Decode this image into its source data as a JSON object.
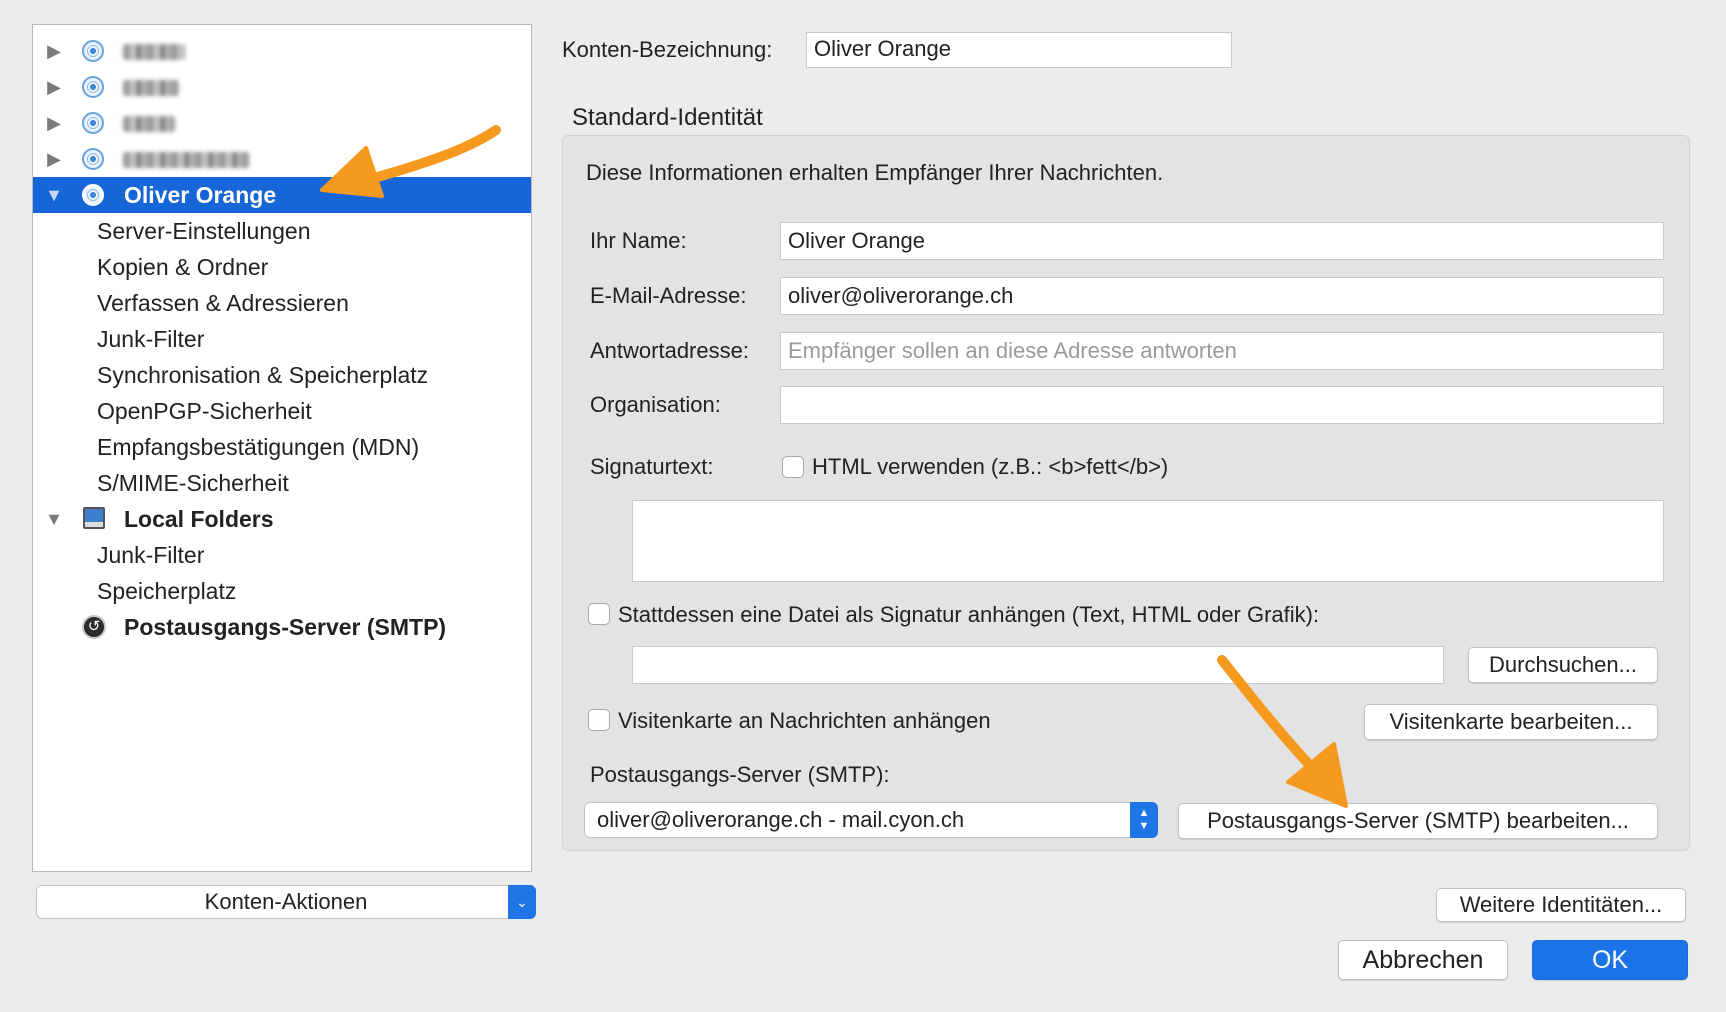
{
  "tree": {
    "accounts_collapsed_count": 4,
    "selected_account": "Oliver Orange",
    "account_children": [
      "Server-Einstellungen",
      "Kopien & Ordner",
      "Verfassen & Adressieren",
      "Junk-Filter",
      "Synchronisation & Speicherplatz",
      "OpenPGP-Sicherheit",
      "Empfangsbestätigungen (MDN)",
      "S/MIME-Sicherheit"
    ],
    "local_folders": "Local Folders",
    "local_children": [
      "Junk-Filter",
      "Speicherplatz"
    ],
    "smtp": "Postausgangs-Server (SMTP)"
  },
  "konten_aktionen": "Konten-Aktionen",
  "account": {
    "label": "Konten-Bezeichnung:",
    "value": "Oliver Orange"
  },
  "identity": {
    "title": "Standard-Identität",
    "info": "Diese Informationen erhalten Empfänger Ihrer Nachrichten.",
    "name_label": "Ihr Name:",
    "name_value": "Oliver Orange",
    "email_label": "E-Mail-Adresse:",
    "email_value": "oliver@oliverorange.ch",
    "reply_label": "Antwortadresse:",
    "reply_placeholder": "Empfänger sollen an diese Adresse antworten",
    "org_label": "Organisation:",
    "org_value": "",
    "sig_label": "Signaturtext:",
    "html_checkbox": "HTML verwenden (z.B.: <b>fett</b>)",
    "file_checkbox": "Stattdessen eine Datei als Signatur anhängen (Text, HTML oder Grafik):",
    "browse_button": "Durchsuchen...",
    "vcard_checkbox": "Visitenkarte an Nachrichten anhängen",
    "vcard_button": "Visitenkarte bearbeiten...",
    "smtp_label": "Postausgangs-Server (SMTP):",
    "smtp_value": "oliver@oliverorange.ch - mail.cyon.ch",
    "smtp_button": "Postausgangs-Server (SMTP) bearbeiten..."
  },
  "buttons": {
    "more_identities": "Weitere Identitäten...",
    "cancel": "Abbrechen",
    "ok": "OK"
  },
  "colors": {
    "selection": "#1766d8",
    "accent_button": "#1a74e8",
    "annotation_arrow": "#f59a1e"
  }
}
